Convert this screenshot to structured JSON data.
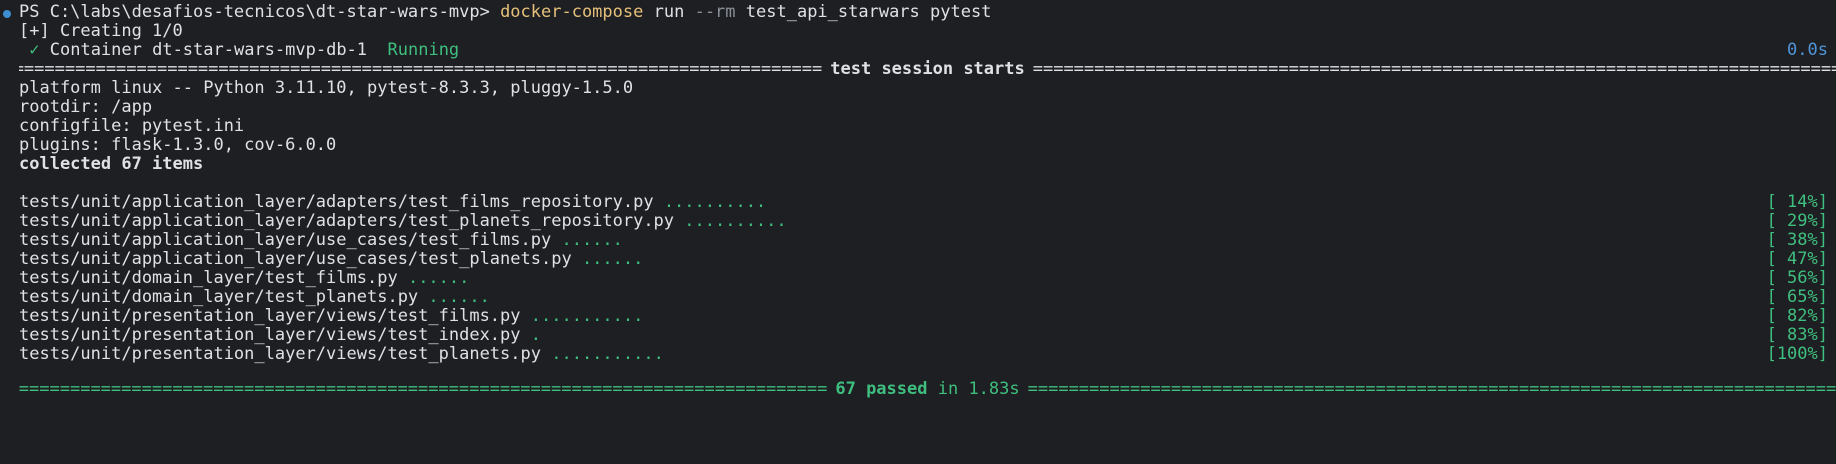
{
  "prompt": {
    "ps_path": "PS C:\\labs\\desafios-tecnicos\\dt-star-wars-mvp>",
    "command": "docker-compose",
    "subcommand": "run",
    "flag": "--rm",
    "args": "test_api_starwars pytest"
  },
  "creating": "[+] Creating 1/0",
  "container": {
    "check_icon": "✓",
    "name": "Container dt-star-wars-mvp-db-1",
    "status": "Running",
    "time": "0.0s"
  },
  "session": {
    "separator_char": "=",
    "title": "test session starts",
    "platform": "platform linux -- Python 3.11.10, pytest-8.3.3, pluggy-1.5.0",
    "rootdir": "rootdir: /app",
    "configfile": "configfile: pytest.ini",
    "plugins": "plugins: flask-1.3.0, cov-6.0.0",
    "collected": "collected 67 items"
  },
  "tests": [
    {
      "file": "tests/unit/application_layer/adapters/test_films_repository.py",
      "dots": "..........",
      "percent": "[ 14%]"
    },
    {
      "file": "tests/unit/application_layer/adapters/test_planets_repository.py",
      "dots": "..........",
      "percent": "[ 29%]"
    },
    {
      "file": "tests/unit/application_layer/use_cases/test_films.py",
      "dots": "......",
      "percent": "[ 38%]"
    },
    {
      "file": "tests/unit/application_layer/use_cases/test_planets.py",
      "dots": "......",
      "percent": "[ 47%]"
    },
    {
      "file": "tests/unit/domain_layer/test_films.py",
      "dots": "......",
      "percent": "[ 56%]"
    },
    {
      "file": "tests/unit/domain_layer/test_planets.py",
      "dots": "......",
      "percent": "[ 65%]"
    },
    {
      "file": "tests/unit/presentation_layer/views/test_films.py",
      "dots": "...........",
      "percent": "[ 82%]"
    },
    {
      "file": "tests/unit/presentation_layer/views/test_index.py",
      "dots": ".",
      "percent": "[ 83%]"
    },
    {
      "file": "tests/unit/presentation_layer/views/test_planets.py",
      "dots": "...........",
      "percent": "[100%]"
    }
  ],
  "summary": {
    "passed": "67 passed",
    "duration": "in 1.83s"
  },
  "colors": {
    "background": "#1e1f22",
    "text": "#dfe1e5",
    "command": "#e5c07b",
    "success": "#3fbf7f",
    "info": "#4e95d9"
  }
}
